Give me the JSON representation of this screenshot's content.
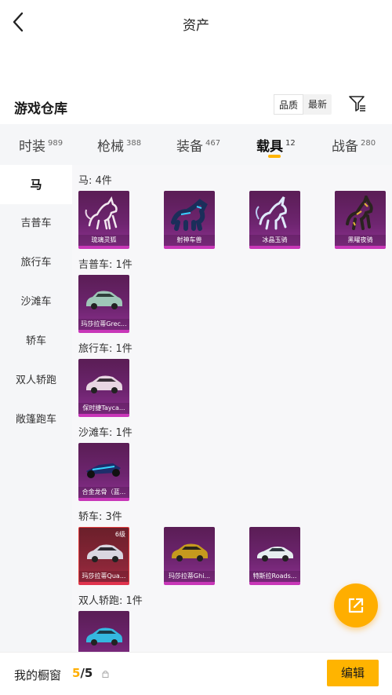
{
  "header": {
    "title": "资产",
    "back_icon": "chevron-left-icon"
  },
  "warehouse": {
    "title": "游戏仓库",
    "sort_options": [
      "品质",
      "最新"
    ],
    "sort_selected": "品质",
    "filter_icon": "filter-icon"
  },
  "tabs": [
    {
      "label": "时装",
      "count": "989"
    },
    {
      "label": "枪械",
      "count": "388"
    },
    {
      "label": "装备",
      "count": "467"
    },
    {
      "label": "载具",
      "count": "12",
      "active": true
    },
    {
      "label": "战备",
      "count": "280"
    }
  ],
  "sidebar": {
    "items": [
      {
        "label": "马",
        "active": true
      },
      {
        "label": "吉普车"
      },
      {
        "label": "旅行车"
      },
      {
        "label": "沙滩车"
      },
      {
        "label": "轿车"
      },
      {
        "label": "双人轿跑"
      },
      {
        "label": "敞篷跑车"
      }
    ]
  },
  "sections": [
    {
      "label": "马: 4件",
      "items": [
        {
          "name": "琉璃灵狐"
        },
        {
          "name": "射神车兽"
        },
        {
          "name": "冰晶玉骑"
        },
        {
          "name": "黑曜夜骑"
        }
      ]
    },
    {
      "label": "吉普车: 1件",
      "items": [
        {
          "name": "玛莎拉蒂Grec..."
        }
      ]
    },
    {
      "label": "旅行车: 1件",
      "items": [
        {
          "name": "保时捷Tayca..."
        }
      ]
    },
    {
      "label": "沙滩车: 1件",
      "items": [
        {
          "name": "合金龙骨（蓝..."
        }
      ]
    },
    {
      "label": "轿车: 3件",
      "items": [
        {
          "name": "玛莎拉蒂Qua...",
          "level": "6级"
        },
        {
          "name": "玛莎拉蒂Ghi..."
        },
        {
          "name": "特斯拉Roads..."
        }
      ]
    },
    {
      "label": "双人轿跑: 1件",
      "items": [
        {
          "name": ""
        }
      ]
    }
  ],
  "fab": {
    "icon": "share-external-icon"
  },
  "bottom": {
    "showcase_label": "我的橱窗",
    "showcase_current": "5",
    "showcase_total": "/5",
    "lock_icon": "lock-icon",
    "edit_label": "编辑"
  },
  "colors": {
    "accent": "#ffb400",
    "card_purple": "#6e2570",
    "card_red": "#8a2638"
  }
}
